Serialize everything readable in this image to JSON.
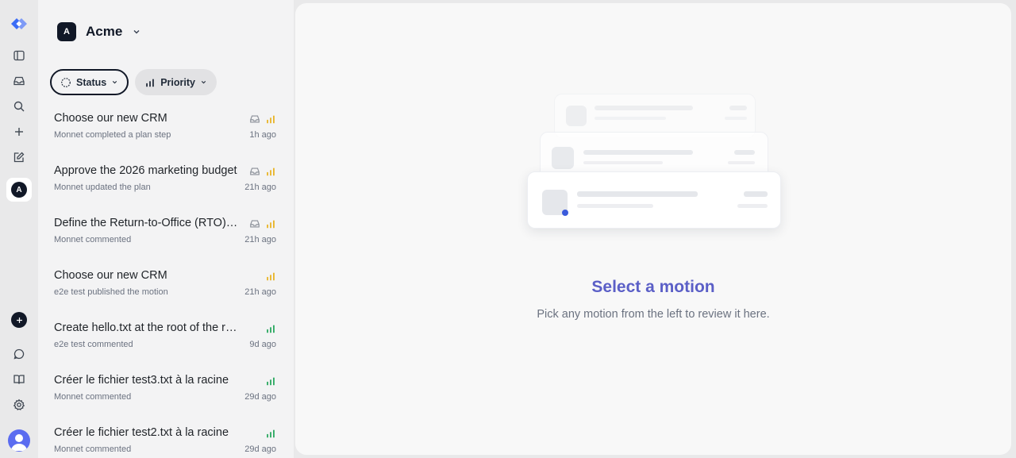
{
  "workspace": {
    "initial": "A",
    "name": "Acme"
  },
  "rail": {
    "active_workspace_initial": "A",
    "icons": [
      "app-logo-icon",
      "sidebar-toggle-icon",
      "inbox-icon",
      "search-icon",
      "plus-icon",
      "compose-icon",
      "workspace-avatar",
      "new-circle-icon",
      "chat-icon",
      "docs-book-icon",
      "settings-icon",
      "user-avatar"
    ]
  },
  "filters": {
    "status_label": "Status",
    "priority_label": "Priority"
  },
  "items": [
    {
      "title": "Choose our new CRM",
      "subtitle": "Monnet completed a plan step",
      "time": "1h ago",
      "inbox": true,
      "priority_color": "#e8b21f"
    },
    {
      "title": "Approve the 2026 marketing budget",
      "subtitle": "Monnet updated the plan",
      "time": "21h ago",
      "inbox": true,
      "priority_color": "#e8b21f"
    },
    {
      "title": "Define the Return-to-Office (RTO) policy",
      "subtitle": "Monnet commented",
      "time": "21h ago",
      "inbox": true,
      "priority_color": "#e8b21f"
    },
    {
      "title": "Choose our new CRM",
      "subtitle": "e2e test published the motion",
      "time": "21h ago",
      "inbox": false,
      "priority_color": "#e8b21f"
    },
    {
      "title": "Create hello.txt at the root of the repo",
      "subtitle": "e2e test commented",
      "time": "9d ago",
      "inbox": false,
      "priority_color": "#22a55a"
    },
    {
      "title": "Créer le fichier test3.txt à la racine",
      "subtitle": "Monnet commented",
      "time": "29d ago",
      "inbox": false,
      "priority_color": "#22a55a"
    },
    {
      "title": "Créer le fichier test2.txt à la racine",
      "subtitle": "Monnet commented",
      "time": "29d ago",
      "inbox": false,
      "priority_color": "#22a55a"
    }
  ],
  "main": {
    "empty_title": "Select a motion",
    "empty_subtitle": "Pick any motion from the left to review it here."
  },
  "colors": {
    "accent": "#5b5fc7",
    "priority_medium": "#e8b21f",
    "priority_low": "#22a55a"
  }
}
